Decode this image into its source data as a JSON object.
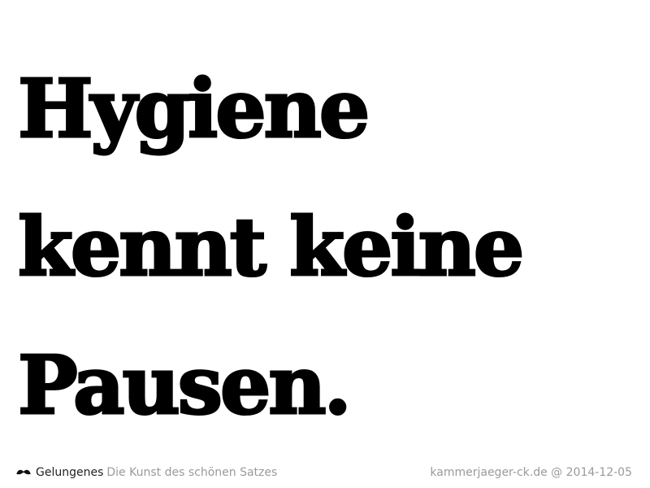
{
  "headline": {
    "lines": [
      "Hygiene",
      "kennt keine",
      "Pausen."
    ]
  },
  "footer": {
    "icon": "mustache-icon",
    "brand": "Gelungenes",
    "tagline": "Die Kunst des schönen Satzes",
    "credit": "kammerjaeger-ck.de @ 2014-12-05"
  },
  "colors": {
    "background": "#ffffff",
    "headline": "#000000",
    "brand": "#222222",
    "muted": "#9a9a9a"
  }
}
